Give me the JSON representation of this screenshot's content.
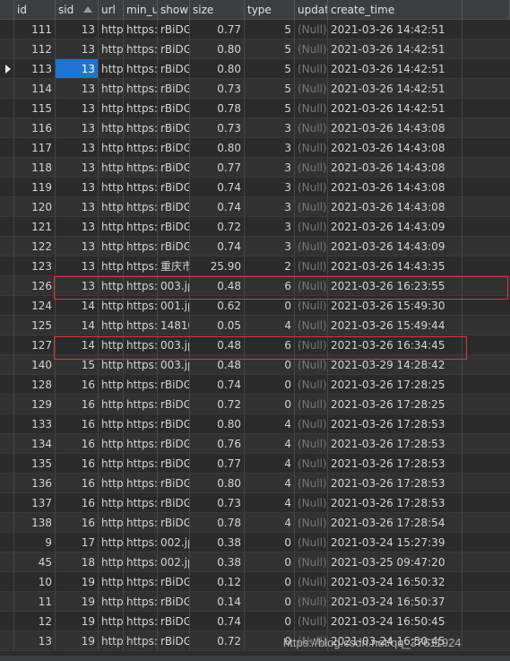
{
  "columns": [
    "id",
    "sid",
    "url",
    "min_ur",
    "show",
    "size",
    "type",
    "updat",
    "create_time"
  ],
  "rows": [
    {
      "id": "111",
      "sid": "13",
      "url": "http",
      "min": "https:/",
      "show": "rBiDG",
      "size": "0.77",
      "type": "5",
      "upd": "(Null)",
      "create": "2021-03-26 14:42:51"
    },
    {
      "id": "112",
      "sid": "13",
      "url": "http",
      "min": "https:/",
      "show": "rBiDG",
      "size": "0.80",
      "type": "5",
      "upd": "(Null)",
      "create": "2021-03-26 14:42:51"
    },
    {
      "id": "113",
      "sid": "13",
      "url": "http",
      "min": "https:/",
      "show": "rBiDG",
      "size": "0.80",
      "type": "5",
      "upd": "(Null)",
      "create": "2021-03-26 14:42:51"
    },
    {
      "id": "114",
      "sid": "13",
      "url": "http",
      "min": "https:/",
      "show": "rBiDG",
      "size": "0.73",
      "type": "5",
      "upd": "(Null)",
      "create": "2021-03-26 14:42:51"
    },
    {
      "id": "115",
      "sid": "13",
      "url": "http",
      "min": "https:/",
      "show": "rBiDG",
      "size": "0.78",
      "type": "5",
      "upd": "(Null)",
      "create": "2021-03-26 14:42:51"
    },
    {
      "id": "116",
      "sid": "13",
      "url": "http",
      "min": "https:/",
      "show": "rBiDG",
      "size": "0.73",
      "type": "3",
      "upd": "(Null)",
      "create": "2021-03-26 14:43:08"
    },
    {
      "id": "117",
      "sid": "13",
      "url": "http",
      "min": "https:/",
      "show": "rBiDG",
      "size": "0.80",
      "type": "3",
      "upd": "(Null)",
      "create": "2021-03-26 14:43:08"
    },
    {
      "id": "118",
      "sid": "13",
      "url": "http",
      "min": "https:/",
      "show": "rBiDG",
      "size": "0.77",
      "type": "3",
      "upd": "(Null)",
      "create": "2021-03-26 14:43:08"
    },
    {
      "id": "119",
      "sid": "13",
      "url": "http",
      "min": "https:/",
      "show": "rBiDG",
      "size": "0.74",
      "type": "3",
      "upd": "(Null)",
      "create": "2021-03-26 14:43:08"
    },
    {
      "id": "120",
      "sid": "13",
      "url": "http",
      "min": "https:/",
      "show": "rBiDG",
      "size": "0.74",
      "type": "3",
      "upd": "(Null)",
      "create": "2021-03-26 14:43:08"
    },
    {
      "id": "121",
      "sid": "13",
      "url": "http",
      "min": "https:/",
      "show": "rBiDG",
      "size": "0.72",
      "type": "3",
      "upd": "(Null)",
      "create": "2021-03-26 14:43:09"
    },
    {
      "id": "122",
      "sid": "13",
      "url": "http",
      "min": "https:/",
      "show": "rBiDG",
      "size": "0.74",
      "type": "3",
      "upd": "(Null)",
      "create": "2021-03-26 14:43:09"
    },
    {
      "id": "123",
      "sid": "13",
      "url": "http",
      "min": "https:/",
      "show": "重庆市",
      "size": "25.90",
      "type": "2",
      "upd": "(Null)",
      "create": "2021-03-26 14:43:35"
    },
    {
      "id": "126",
      "sid": "13",
      "url": "http",
      "min": "https:/",
      "show": "003.jp",
      "size": "0.48",
      "type": "6",
      "upd": "(Null)",
      "create": "2021-03-26 16:23:55"
    },
    {
      "id": "124",
      "sid": "14",
      "url": "http",
      "min": "https:/",
      "show": "001.jp",
      "size": "0.62",
      "type": "0",
      "upd": "(Null)",
      "create": "2021-03-26 15:49:30"
    },
    {
      "id": "125",
      "sid": "14",
      "url": "http",
      "min": "https:/",
      "show": "14810",
      "size": "0.05",
      "type": "4",
      "upd": "(Null)",
      "create": "2021-03-26 15:49:44"
    },
    {
      "id": "127",
      "sid": "14",
      "url": "http",
      "min": "https:/",
      "show": "003.jp",
      "size": "0.48",
      "type": "6",
      "upd": "(Null)",
      "create": "2021-03-26 16:34:45"
    },
    {
      "id": "140",
      "sid": "15",
      "url": "http",
      "min": "https:/",
      "show": "003.jp",
      "size": "0.48",
      "type": "0",
      "upd": "(Null)",
      "create": "2021-03-29 14:28:42"
    },
    {
      "id": "128",
      "sid": "16",
      "url": "http",
      "min": "https:/",
      "show": "rBiDG",
      "size": "0.74",
      "type": "0",
      "upd": "(Null)",
      "create": "2021-03-26 17:28:25"
    },
    {
      "id": "129",
      "sid": "16",
      "url": "http",
      "min": "https:/",
      "show": "rBiDG",
      "size": "0.72",
      "type": "0",
      "upd": "(Null)",
      "create": "2021-03-26 17:28:25"
    },
    {
      "id": "133",
      "sid": "16",
      "url": "http",
      "min": "https:/",
      "show": "rBiDG",
      "size": "0.80",
      "type": "4",
      "upd": "(Null)",
      "create": "2021-03-26 17:28:53"
    },
    {
      "id": "134",
      "sid": "16",
      "url": "http",
      "min": "https:/",
      "show": "rBiDG",
      "size": "0.76",
      "type": "4",
      "upd": "(Null)",
      "create": "2021-03-26 17:28:53"
    },
    {
      "id": "135",
      "sid": "16",
      "url": "http",
      "min": "https:/",
      "show": "rBiDG",
      "size": "0.77",
      "type": "4",
      "upd": "(Null)",
      "create": "2021-03-26 17:28:53"
    },
    {
      "id": "136",
      "sid": "16",
      "url": "http",
      "min": "https:/",
      "show": "rBiDG",
      "size": "0.80",
      "type": "4",
      "upd": "(Null)",
      "create": "2021-03-26 17:28:53"
    },
    {
      "id": "137",
      "sid": "16",
      "url": "http",
      "min": "https:/",
      "show": "rBiDG",
      "size": "0.73",
      "type": "4",
      "upd": "(Null)",
      "create": "2021-03-26 17:28:53"
    },
    {
      "id": "138",
      "sid": "16",
      "url": "http",
      "min": "https:/",
      "show": "rBiDG",
      "size": "0.78",
      "type": "4",
      "upd": "(Null)",
      "create": "2021-03-26 17:28:54"
    },
    {
      "id": "9",
      "sid": "17",
      "url": "http",
      "min": "https:/",
      "show": "002.jp",
      "size": "0.38",
      "type": "0",
      "upd": "(Null)",
      "create": "2021-03-24 15:27:39"
    },
    {
      "id": "45",
      "sid": "18",
      "url": "http",
      "min": "https:/",
      "show": "002.jp",
      "size": "0.38",
      "type": "0",
      "upd": "(Null)",
      "create": "2021-03-25 09:47:20"
    },
    {
      "id": "10",
      "sid": "19",
      "url": "http",
      "min": "https:/",
      "show": "rBiDG",
      "size": "0.12",
      "type": "0",
      "upd": "(Null)",
      "create": "2021-03-24 16:50:32"
    },
    {
      "id": "11",
      "sid": "19",
      "url": "http",
      "min": "https:/",
      "show": "rBiDG",
      "size": "0.14",
      "type": "0",
      "upd": "(Null)",
      "create": "2021-03-24 16:50:37"
    },
    {
      "id": "12",
      "sid": "19",
      "url": "http",
      "min": "https:/",
      "show": "rBiDG",
      "size": "0.74",
      "type": "0",
      "upd": "(Null)",
      "create": "2021-03-24 16:50:45"
    },
    {
      "id": "13",
      "sid": "19",
      "url": "http",
      "min": "https:/",
      "show": "rBiDG",
      "size": "0.72",
      "type": "0",
      "upd": "(Null)",
      "create": "2021-03-24 16:50:45"
    }
  ],
  "current_row_index": 2,
  "selected_column": "sid",
  "sorted_column": "sid",
  "highlighted_row_indices": [
    13,
    16
  ],
  "watermark": "https://blog.csdn.net/qq_37611924",
  "colors": {
    "background": "#2b2b2b",
    "selection": "#1e74d0",
    "highlight_border": "#d23a3a",
    "null_text": "#777777"
  }
}
